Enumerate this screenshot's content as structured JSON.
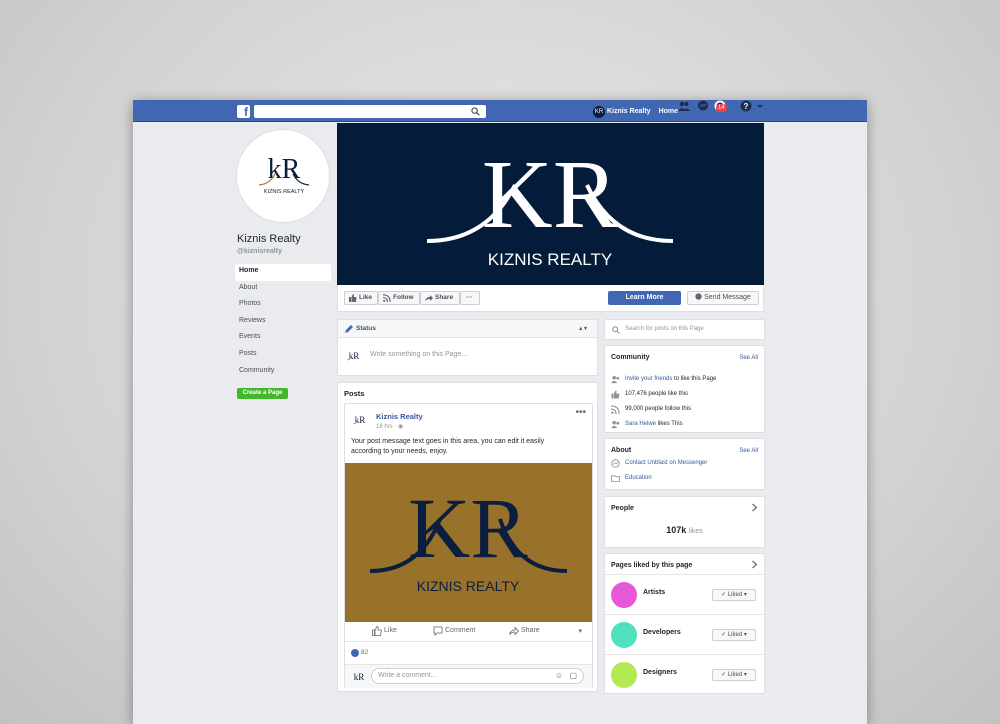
{
  "colors": {
    "brand_blue": "#4267b2",
    "cover_navy": "#051b3a",
    "post_image_gold": "#98712a",
    "create_green": "#42b72a"
  },
  "topbar": {
    "logo": "f",
    "search_placeholder": "",
    "profile_name": "Kiznis Realty",
    "home_label": "Home",
    "notification_count": "14"
  },
  "page": {
    "name": "Kiznis Realty",
    "handle": "@kiznisrealty",
    "logo_text": "KIZNIS REALTY"
  },
  "leftnav": {
    "items": [
      "Home",
      "About",
      "Photos",
      "Reviews",
      "Events",
      "Posts",
      "Community"
    ],
    "create_page": "Create a Page"
  },
  "cover": {
    "monogram": "KR",
    "brand": "KIZNIS REALTY"
  },
  "actions": {
    "like": "Like",
    "follow": "Follow",
    "share": "Share",
    "more": "···",
    "learn_more": "Learn More",
    "send_message": "Send Message"
  },
  "status": {
    "title": "Status",
    "placeholder": "Write something on this Page..."
  },
  "posts": {
    "title": "Posts",
    "post": {
      "author": "Kiznis Realty",
      "time": "18 hrs",
      "text": "Your post message text goes in this area, you can edit it easily according to your needs, enjoy.",
      "image_monogram": "KR",
      "image_brand": "KIZNIS REALTY",
      "like": "Like",
      "comment": "Comment",
      "share": "Share",
      "reactions": "82",
      "comment_placeholder": "Write a comment..."
    }
  },
  "right": {
    "search_placeholder": "Search for posts on this Page",
    "community": {
      "title": "Community",
      "see_all": "See All",
      "invite_link": "Invite your friends",
      "invite_rest": "to like this Page",
      "likes": "107,476 people like this",
      "follows": "99,000 people follow this",
      "friend_name": "Sara Helwe",
      "friend_rest": "likes This"
    },
    "about": {
      "title": "About",
      "see_all": "See All",
      "contact": "Contact Unblast on Messenger",
      "category": "Education"
    },
    "people": {
      "title": "People",
      "count": "107k",
      "label": "likes"
    },
    "pages_liked": {
      "title": "Pages liked by this page",
      "items": [
        {
          "name": "Artists",
          "button": "Liked",
          "color": "#e758d6"
        },
        {
          "name": "Developers",
          "button": "Liked",
          "color": "#4fe0bd"
        },
        {
          "name": "Designers",
          "button": "Liked",
          "color": "#b3ea53"
        }
      ]
    }
  }
}
